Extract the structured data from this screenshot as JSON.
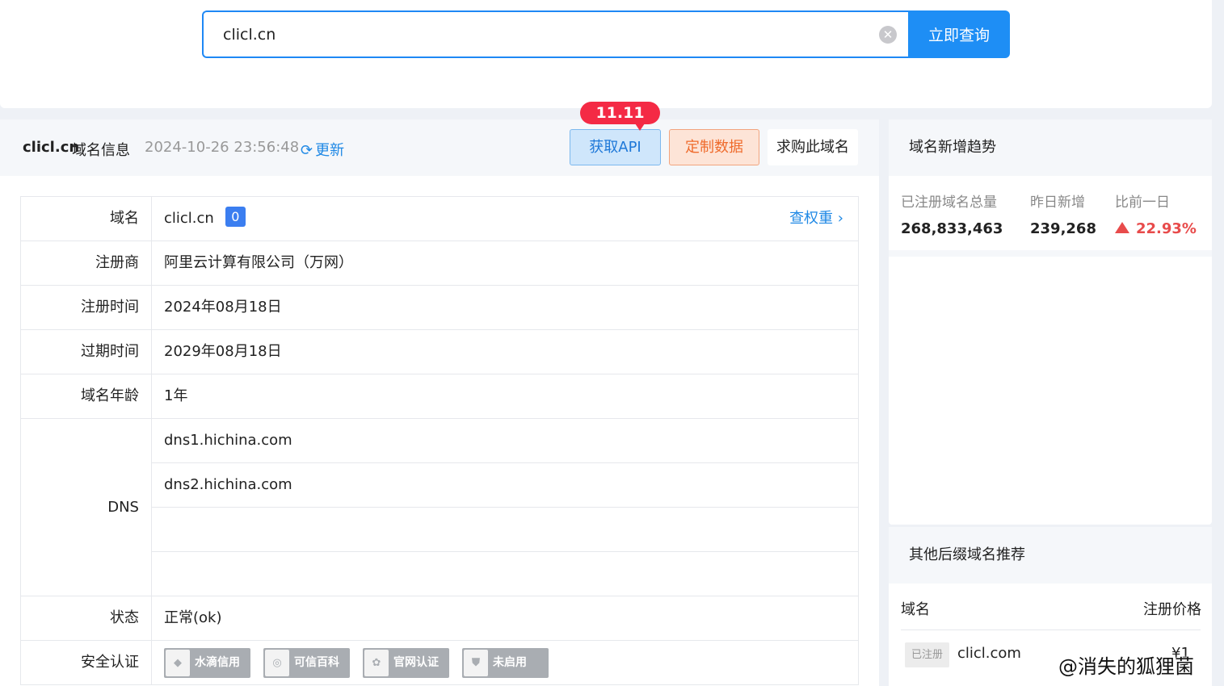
{
  "search": {
    "query": "clicl.cn",
    "button_label": "立即查询"
  },
  "header": {
    "domain": "clicl.cn",
    "suffix": "域名信息",
    "timestamp": "2024-10-26 23:56:48",
    "refresh_label": "更新",
    "promo_badge": "11.11",
    "api_label": "获取API",
    "custom_label": "定制数据",
    "buy_label": "求购此域名"
  },
  "info": {
    "domain_label": "域名",
    "domain_value": "clicl.cn",
    "domain_count": "0",
    "weight_link": "查权重",
    "registrar_label": "注册商",
    "registrar_value": "阿里云计算有限公司（万网）",
    "reg_time_label": "注册时间",
    "reg_time_value": "2024年08月18日",
    "exp_time_label": "过期时间",
    "exp_time_value": "2029年08月18日",
    "age_label": "域名年龄",
    "age_value": "1年",
    "dns_label": "DNS",
    "dns": [
      "dns1.hichina.com",
      "dns2.hichina.com",
      "",
      ""
    ],
    "status_label": "状态",
    "status_value": "正常(ok)",
    "security_label": "安全认证",
    "certs": [
      "水滴信用",
      "可信百科",
      "官网认证",
      "未启用"
    ]
  },
  "trend": {
    "title": "域名新增趋势",
    "total_label": "已注册域名总量",
    "total_value": "268,833,463",
    "new_label": "昨日新增",
    "new_value": "239,268",
    "compare_label": "比前一日",
    "compare_value": "22.93%",
    "compare_color": "#e84b4b"
  },
  "recommend": {
    "title": "其他后缀域名推荐",
    "col_domain": "域名",
    "col_price": "注册价格",
    "rows": [
      {
        "tag": "已注册",
        "domain": "clicl.com",
        "price": "¥1"
      }
    ]
  },
  "watermark": "@消失的狐狸菌"
}
